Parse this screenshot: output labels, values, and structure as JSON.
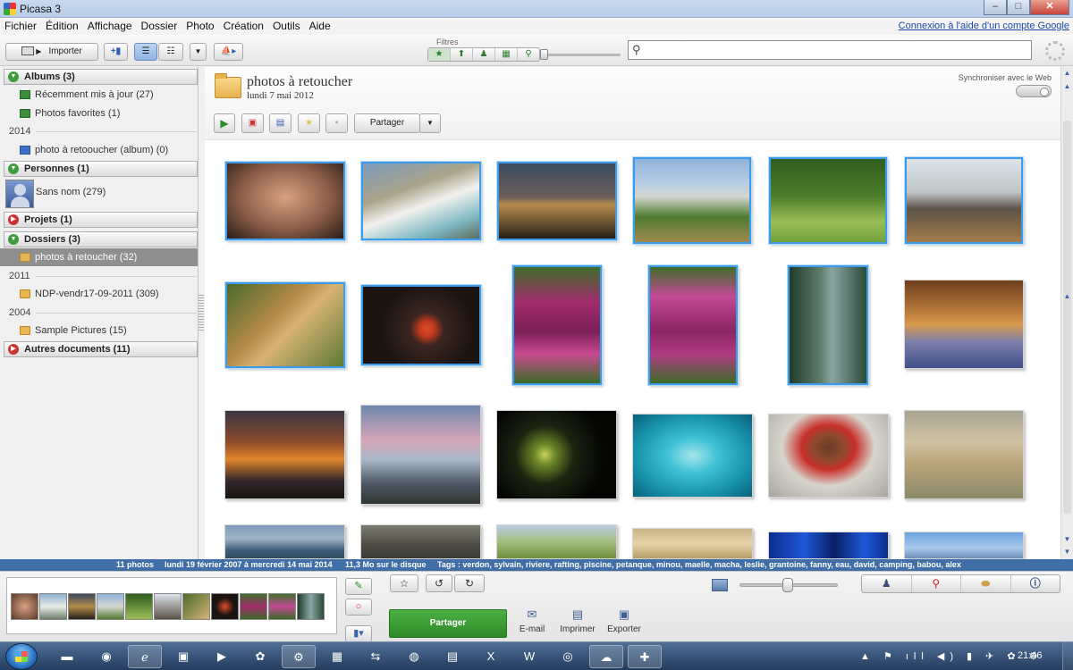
{
  "window": {
    "title": "Picasa 3",
    "min": "–",
    "max": "□",
    "close": "✕"
  },
  "menu": {
    "items": [
      "Fichier",
      "Édition",
      "Affichage",
      "Dossier",
      "Photo",
      "Création",
      "Outils",
      "Aide"
    ],
    "google_link": "Connexion à l'aide d'un compte Google"
  },
  "toolbar": {
    "import_label": "Importer",
    "filters_label": "Filtres",
    "filter_icons": [
      "star-filter",
      "upload-filter",
      "people-filter",
      "video-filter",
      "geotag-filter"
    ],
    "search": {
      "value": "",
      "placeholder": ""
    }
  },
  "sidebar": {
    "albums": {
      "label": "Albums (3)"
    },
    "album_items": [
      "Récemment mis à jour (27)",
      "Photos favorites (1)"
    ],
    "year_2014": "2014",
    "album_2014": "photo à retooucher (album) (0)",
    "people": {
      "label": "Personnes (1)"
    },
    "person": "Sans nom (279)",
    "projects": {
      "label": "Projets (1)"
    },
    "folders": {
      "label": "Dossiers (3)"
    },
    "folder_selected": "photos à retoucher (32)",
    "year_2011": "2011",
    "folder_2011": "NDP-vendr17-09-2011 (309)",
    "year_2004": "2004",
    "folder_2004": "Sample Pictures (15)",
    "other": {
      "label": "Autres documents (11)"
    }
  },
  "main": {
    "folder_title": "photos à retoucher",
    "folder_date": "lundi 7 mai 2012",
    "sync_label": "Synchroniser avec le Web",
    "share_label": "Partager"
  },
  "status": {
    "count": "11 photos",
    "date_range": "lundi 19 février 2007 à mercredi 14 mai 2014",
    "disk": "11,3 Mo sur le disque",
    "tags": "Tags : verdon, sylvain, riviere, rafting, piscine, petanque, minou, maelle, macha, leslie, grantoine, fanny, eau, david, camping, babou, alex"
  },
  "bottom": {
    "share_label": "Partager",
    "email_label": "E-mail",
    "print_label": "Imprimer",
    "export_label": "Exporter"
  },
  "taskbar": {
    "clock": "21:46"
  },
  "colors": {
    "accent": "#3d9be9",
    "status_bar": "#3f6fa6",
    "share_green": "#2e8a28",
    "selected_sidebar": "#8f8f8f"
  }
}
